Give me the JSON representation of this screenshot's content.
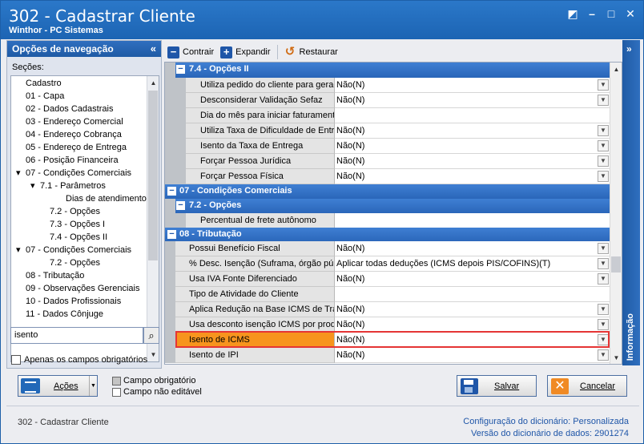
{
  "window": {
    "title": "302 - Cadastrar Cliente",
    "subtitle": "Winthor - PC Sistemas",
    "buttons": {
      "restore": "◩",
      "minimize": "–",
      "maximize": "□",
      "close": "✕"
    }
  },
  "nav": {
    "header": "Opções de navegação",
    "collapse": "«",
    "sections_label": "Seções:",
    "tree": [
      {
        "label": "Cadastro",
        "expander": ""
      },
      {
        "label": "01 - Capa",
        "expander": ""
      },
      {
        "label": "02 - Dados Cadastrais",
        "expander": ""
      },
      {
        "label": "03 - Endereço Comercial",
        "expander": ""
      },
      {
        "label": "04 - Endereço Cobrança",
        "expander": ""
      },
      {
        "label": "05 - Endereço de Entrega",
        "expander": ""
      },
      {
        "label": "06 - Posição Financeira",
        "expander": ""
      },
      {
        "label": "07 - Condições Comerciais",
        "expander": "▾"
      },
      {
        "label": "7.1 - Parâmetros",
        "expander": "▾"
      },
      {
        "label": "Dias de atendimento",
        "expander": ""
      },
      {
        "label": "7.2 - Opções",
        "expander": ""
      },
      {
        "label": "7.3 - Opções I",
        "expander": ""
      },
      {
        "label": "7.4 - Opções II",
        "expander": ""
      },
      {
        "label": "07 - Condições Comerciais",
        "expander": "▾"
      },
      {
        "label": "7.2 - Opções",
        "expander": ""
      },
      {
        "label": "08 - Tributação",
        "expander": ""
      },
      {
        "label": "09 - Observações Gerenciais",
        "expander": ""
      },
      {
        "label": "10 - Dados Profissionais",
        "expander": ""
      },
      {
        "label": "11 - Dados Cônjuge",
        "expander": ""
      }
    ],
    "search_value": "isento",
    "search_icon": "magnifier-icon",
    "only_required_label": "Apenas os campos obrigatórios"
  },
  "toolbar": {
    "collapse_label": "Contrair",
    "expand_label": "Expandir",
    "restore_label": "Restaurar",
    "collapse_glyph": "−",
    "expand_glyph": "+",
    "restore_glyph": "↺"
  },
  "grid": {
    "sections": {
      "s74": {
        "sign": "−",
        "label": "7.4 - Opções II"
      },
      "s07": {
        "sign": "−",
        "label": "07 - Condições Comerciais"
      },
      "s72": {
        "sign": "−",
        "label": "7.2 - Opções"
      },
      "s08": {
        "sign": "−",
        "label": "08 - Tributação"
      }
    },
    "rows": [
      {
        "prop": "Utiliza pedido do cliente para geração",
        "value": "Não(N)"
      },
      {
        "prop": "Desconsiderar Validação Sefaz",
        "value": "Não(N)"
      },
      {
        "prop": "Dia do mês para iniciar faturamento",
        "value": ""
      },
      {
        "prop": "Utiliza Taxa de Dificuldade de Entrega",
        "value": "Não(N)"
      },
      {
        "prop": "Isento da Taxa de Entrega",
        "value": "Não(N)"
      },
      {
        "prop": "Forçar Pessoa Jurídica",
        "value": "Não(N)"
      },
      {
        "prop": "Forçar Pessoa Física",
        "value": "Não(N)"
      },
      {
        "prop": "Percentual de frete autônomo",
        "value": ""
      },
      {
        "prop": "Possui Benefício Fiscal",
        "value": "Não(N)"
      },
      {
        "prop": "% Desc. Isenção (Suframa, órgão público)",
        "value": "Aplicar todas deduções (ICMS depois PIS/COFINS)(T)"
      },
      {
        "prop": "Usa IVA Fonte Diferenciado",
        "value": "Não(N)"
      },
      {
        "prop": "Tipo de Atividade do Cliente",
        "value": ""
      },
      {
        "prop": "Aplica Redução na Base ICMS de Transferência",
        "value": "Não(N)"
      },
      {
        "prop": "Usa desconto isenção ICMS por produto",
        "value": "Não(N)"
      },
      {
        "prop": "Isento de ICMS",
        "value": "Não(N)"
      },
      {
        "prop": "Isento de IPI",
        "value": "Não(N)"
      }
    ]
  },
  "info_panel": {
    "label": "Informação",
    "arrow": "»"
  },
  "actions": {
    "acoes_label": "Ações",
    "legend_required": "Campo obrigatório",
    "legend_not_editable": "Campo não editável",
    "save_label": "Salvar",
    "cancel_label": "Cancelar",
    "cancel_glyph": "✕"
  },
  "footer": {
    "left": "302 - Cadastrar Cliente",
    "config_label": "Configuração do dicionário:",
    "config_value": "Personalizada",
    "version_label": "Versão do dicionário de dados:",
    "version_value": "2901274"
  }
}
